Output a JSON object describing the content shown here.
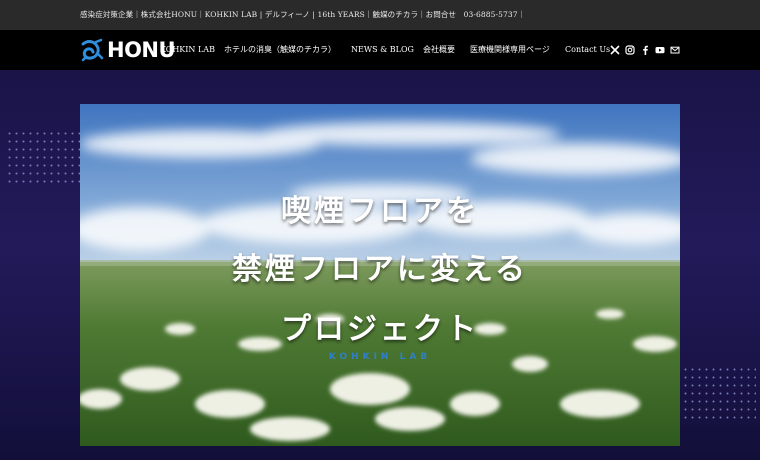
{
  "top_bar": {
    "text": "感染症対策企業｜株式会社HONU｜KOHKIN LAB | デルフィーノ | 16th YEARS｜触媒のチカラ｜お問合せ　03-6885-5737｜"
  },
  "logo": {
    "text": "HONU"
  },
  "nav": {
    "items": [
      "KOHKIN LAB",
      "ホテルの消臭（触媒のチカラ）",
      "NEWS & BLOG",
      "会社概要",
      "医療機関様専用ページ",
      "Contact Us"
    ]
  },
  "social_icons": [
    "x-icon",
    "instagram-icon",
    "facebook-icon",
    "youtube-icon",
    "mail-icon"
  ],
  "hero": {
    "line1": "喫煙フロアを",
    "line2": "禁煙フロアに変える",
    "line3": "プロジェクト",
    "subtitle": "KOHKIN LAB"
  },
  "colors": {
    "top_bar_bg": "#2a2a2a",
    "nav_bg": "#000000",
    "hero_bg": "#1a1448",
    "logo_accent": "#2f8fdc",
    "subtitle": "#2f7fc9"
  }
}
